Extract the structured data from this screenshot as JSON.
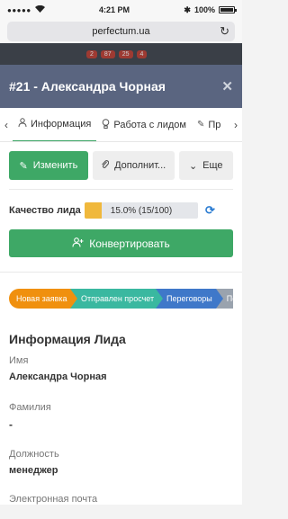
{
  "status_bar": {
    "time": "4:21 PM",
    "battery": "100%"
  },
  "browser": {
    "url": "perfectum.ua"
  },
  "background": {
    "badges": [
      "2",
      "87",
      "25",
      "4"
    ]
  },
  "modal": {
    "title": "#21 - Александра Чорная"
  },
  "tabs": [
    {
      "label": "Информация",
      "icon": "user-icon"
    },
    {
      "label": "Работа с лидом",
      "icon": "lightbulb-icon"
    },
    {
      "label": "Пр",
      "icon": "pencil-icon"
    }
  ],
  "actions": {
    "edit_label": "Изменить",
    "attach_label": "Дополнит...",
    "more_label": "Еще"
  },
  "quality": {
    "label": "Качество лида",
    "text": "15.0% (15/100)",
    "fraction": 0.15
  },
  "convert_label": "Конвертировать",
  "pipeline": [
    {
      "label": "Новая заявка",
      "color": "#f0900e"
    },
    {
      "label": "Отправлен просчет",
      "color": "#3ab8a0"
    },
    {
      "label": "Переговоры",
      "color": "#3f78c9"
    },
    {
      "label": "По",
      "color": "#9aa3ae"
    }
  ],
  "info": {
    "title": "Информация Лида",
    "fields": [
      {
        "label": "Имя",
        "value": "Александра Чорная"
      },
      {
        "label": "Фамилия",
        "value": "-"
      },
      {
        "label": "Должность",
        "value": "менеджер"
      },
      {
        "label": "Электронная почта",
        "value": ""
      }
    ]
  }
}
